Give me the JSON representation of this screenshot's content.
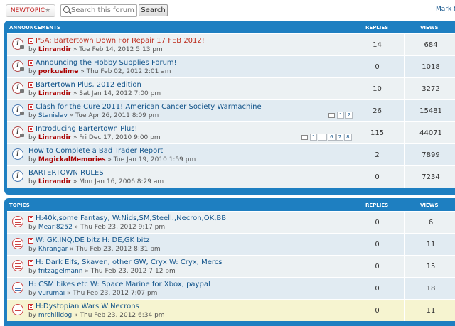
{
  "toolbar": {
    "new_topic_label": "NEWTOPIC",
    "new_topic_star": "★",
    "search_placeholder": "Search this forum…",
    "search_button": "Search",
    "mark_link": "Mark t"
  },
  "announcements": {
    "header": {
      "title": "ANNOUNCEMENTS",
      "replies": "REPLIES",
      "views": "VIEWS"
    },
    "rows": [
      {
        "title": "PSA: Bartertown Down For Repair 17 FEB 2012!",
        "title_color": "red",
        "author": "Linrandir",
        "date": "» Tue Feb 14, 2012 5:13 pm",
        "replies": "14",
        "views": "684",
        "pages": []
      },
      {
        "title": "Announcing the Hobby Supplies Forum!",
        "author": "porkuslime",
        "date": "» Thu Feb 02, 2012 2:01 am",
        "replies": "0",
        "views": "1018",
        "pages": []
      },
      {
        "title": "Bartertown Plus, 2012 edition",
        "author": "Linrandir",
        "date": "» Sat Jan 14, 2012 7:00 pm",
        "replies": "10",
        "views": "3272",
        "pages": []
      },
      {
        "title": "Clash for the Cure 2011! American Cancer Society Warmachine",
        "author": "Stanislav",
        "date": "» Tue Apr 26, 2011 8:09 pm",
        "replies": "26",
        "views": "15481",
        "pages": [
          "1",
          "2"
        ]
      },
      {
        "title": "Introducing Bartertown Plus!",
        "author": "Linrandir",
        "date": "» Fri Dec 17, 2010 9:00 pm",
        "replies": "115",
        "views": "44071",
        "pages": [
          "1",
          "...",
          "6",
          "7",
          "8"
        ]
      },
      {
        "title": "How to Complete a Bad Trader Report",
        "author": "MagickalMemories",
        "date": "» Tue Jan 19, 2010 1:59 pm",
        "replies": "2",
        "views": "7899",
        "pages": []
      },
      {
        "title": "BARTERTOWN RULES",
        "author": "Linrandir",
        "date": "» Mon Jan 16, 2006 8:29 am",
        "replies": "0",
        "views": "7234",
        "pages": []
      }
    ]
  },
  "topics": {
    "header": {
      "title": "TOPICS",
      "replies": "REPLIES",
      "views": "VIEWS"
    },
    "rows": [
      {
        "title": "H:40k,some Fantasy, W:Nids,SM,Steell.,Necron,OK,BB",
        "author": "Mearl8252",
        "date": "» Thu Feb 23, 2012 9:17 pm",
        "replies": "0",
        "views": "6"
      },
      {
        "title": "W: GK,INQ,DE bitz H: DE,GK bitz",
        "author": "Khrangar",
        "date": "» Thu Feb 23, 2012 8:31 pm",
        "replies": "0",
        "views": "11"
      },
      {
        "title": "H: Dark Elfs, Skaven, other GW, Cryx W: Cryx, Mercs",
        "author": "fritzagelmann",
        "date": "» Thu Feb 23, 2012 7:12 pm",
        "replies": "0",
        "views": "15"
      },
      {
        "title": "H: CSM bikes etc W: Space Marine for Xbox, paypal",
        "author": "vurumai",
        "date": "» Thu Feb 23, 2012 7:07 pm",
        "replies": "0",
        "views": "18"
      },
      {
        "title": "H:Dystopian Wars W:Necrons",
        "author": "mrchilidog",
        "date": "» Thu Feb 23, 2012 6:34 pm",
        "replies": "0",
        "views": "11"
      }
    ]
  }
}
